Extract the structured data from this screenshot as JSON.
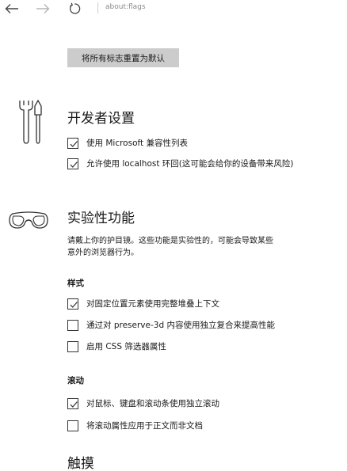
{
  "toolbar": {
    "back_icon": "arrow-left-icon",
    "forward_icon": "arrow-right-icon",
    "refresh_icon": "refresh-icon",
    "address": "about:flags"
  },
  "reset_button": "将所有标志重置为默认",
  "developer": {
    "icon": "tools-icon",
    "title": "开发者设置",
    "options": [
      {
        "label": "使用 Microsoft 兼容性列表",
        "checked": true
      },
      {
        "label": "允许使用 localhost 环回(这可能会给你的设备带来风险)",
        "checked": true
      }
    ]
  },
  "experimental": {
    "icon": "goggles-icon",
    "title": "实验性功能",
    "description_line1": "请戴上你的护目镜。这些功能是实验性的，可能会导致某些",
    "description_line2": "意外的浏览器行为。",
    "styles": {
      "title": "样式",
      "options": [
        {
          "label": "对固定位置元素使用完整堆叠上下文",
          "checked": true
        },
        {
          "label": "通过对 preserve-3d 内容使用独立复合来提高性能",
          "checked": false
        },
        {
          "label": "启用 CSS 筛选器属性",
          "checked": false
        }
      ]
    },
    "scrolling": {
      "title": "滚动",
      "options": [
        {
          "label": "对鼠标、键盘和滚动条使用独立滚动",
          "checked": true
        },
        {
          "label": "将滚动属性应用于正文而非文档",
          "checked": false
        }
      ]
    }
  },
  "touch": {
    "title": "触摸"
  },
  "colors": {
    "background": "#ffffff",
    "button_bg": "#cccccc",
    "text": "#1a1a1a",
    "address_text": "#8a8a8a"
  }
}
